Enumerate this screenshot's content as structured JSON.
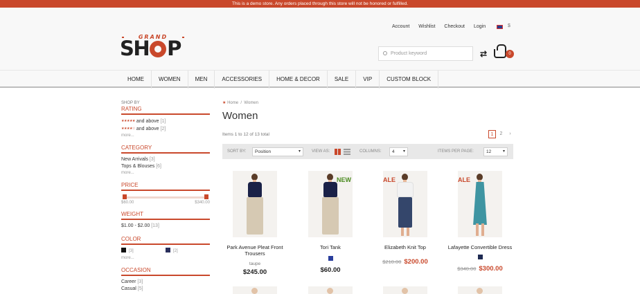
{
  "demo_notice": "This is a demo store. Any orders placed through this store will not be honored or fulfilled.",
  "brand": {
    "top": "GRAND",
    "main_pre": "SH",
    "main_post": "P"
  },
  "top_links": [
    "Account",
    "Wishlist",
    "Checkout",
    "Login"
  ],
  "currency": "$",
  "search": {
    "placeholder": "Product keyword"
  },
  "cart": {
    "count": "0"
  },
  "nav": [
    "HOME",
    "WOMEN",
    "MEN",
    "ACCESSORIES",
    "HOME & DECOR",
    "SALE",
    "VIP",
    "CUSTOM BLOCK"
  ],
  "sidebar": {
    "shop_by": "SHOP BY",
    "rating": {
      "title": "RATING",
      "items": [
        {
          "label": "and above",
          "count": "[1]"
        },
        {
          "label": "and above",
          "count": "[2]"
        }
      ],
      "more": "more..."
    },
    "category": {
      "title": "CATEGORY",
      "items": [
        {
          "label": "New Arrivals",
          "count": "[3]"
        },
        {
          "label": "Tops & Blouses",
          "count": "[6]"
        }
      ],
      "more": "more..."
    },
    "price": {
      "title": "PRICE",
      "min": "$60.00",
      "max": "$340.00"
    },
    "weight": {
      "title": "WEIGHT",
      "items": [
        {
          "label": "$1.00 - $2.00",
          "count": "[13]"
        }
      ]
    },
    "color": {
      "title": "COLOR",
      "items": [
        {
          "count": "[3]",
          "hex": "#111111"
        },
        {
          "count": "[2]",
          "hex": "#2a2f5c"
        }
      ],
      "more": "more..."
    },
    "occasion": {
      "title": "OCCASION",
      "items": [
        {
          "label": "Career",
          "count": "[3]"
        },
        {
          "label": "Casual",
          "count": "[5]"
        }
      ]
    }
  },
  "breadcrumb": {
    "home": "Home",
    "current": "Women"
  },
  "page_title": "Women",
  "items_count": "Items 1 to 12 of 13 total",
  "pager": {
    "current": "1",
    "next": "2"
  },
  "toolbar": {
    "sort_label": "SORT BY:",
    "sort_value": "Position",
    "view_label": "VIEW AS:",
    "columns_label": "COLUMNS:",
    "columns_value": "4",
    "per_page_label": "ITEMS PER PAGE:",
    "per_page_value": "12"
  },
  "products": [
    {
      "name": "Park Avenue Pleat Front Trousers",
      "color_label": "taupe",
      "price": "$245.00",
      "old_price": "",
      "tag": ""
    },
    {
      "name": "Tori Tank",
      "swatch": "#2a3e9c",
      "price": "$60.00",
      "old_price": "",
      "tag": "NEW"
    },
    {
      "name": "Elizabeth Knit Top",
      "price": "$200.00",
      "old_price": "$210.00",
      "tag": "SALE"
    },
    {
      "name": "Lafayette Convertible Dress",
      "swatch": "#1e2a52",
      "price": "$300.00",
      "old_price": "$340.00",
      "tag": "SALE"
    }
  ],
  "colors": {
    "accent": "#c9482b",
    "new_tag": "#4a8a1f"
  }
}
